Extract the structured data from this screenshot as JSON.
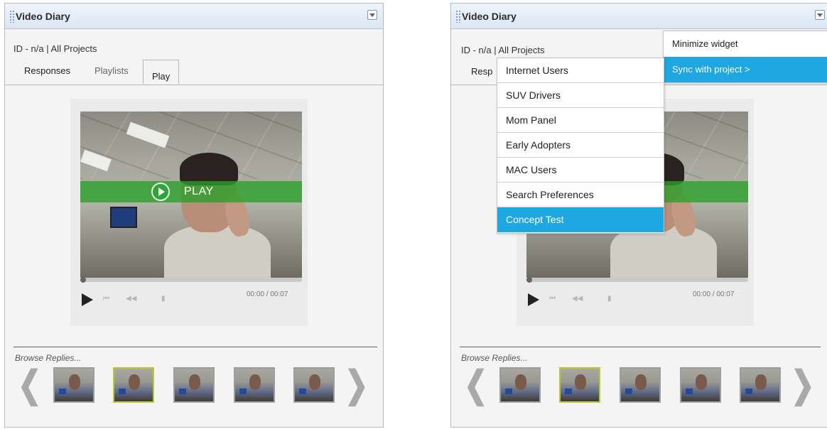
{
  "left": {
    "title": "Video Diary",
    "breadcrumb": "ID - n/a | All Projects",
    "tabs": [
      {
        "label": "Responses"
      },
      {
        "label": "Playlists"
      },
      {
        "label": "Play"
      }
    ],
    "play_overlay": "PLAY",
    "time": "00:00 / 00:07",
    "browse_label": "Browse Replies...",
    "prev_arrow": "❮",
    "next_arrow": "❯"
  },
  "right": {
    "title": "Video Diary",
    "breadcrumb": "ID - n/a | All Projects",
    "tab_partial": "Resp",
    "time": "00:00 / 00:07",
    "browse_label": "Browse Replies...",
    "prev_arrow": "❮",
    "next_arrow": "❯",
    "widget_menu": [
      {
        "label": "Minimize widget"
      },
      {
        "label": "Sync with project >"
      }
    ],
    "project_menu": [
      {
        "label": "Internet Users"
      },
      {
        "label": "SUV Drivers"
      },
      {
        "label": "Mom Panel"
      },
      {
        "label": "Early Adopters"
      },
      {
        "label": "MAC Users"
      },
      {
        "label": "Search Preferences"
      },
      {
        "label": "Concept Test"
      }
    ]
  },
  "colors": {
    "menu_highlight": "#1ea7e1",
    "play_bar": "#2fa23a",
    "selected_thumb_border": "#b9c832"
  },
  "icons": {
    "grip": "drag-handle-icon",
    "menu": "dropdown-menu-icon",
    "play": "play-icon",
    "skip_back": "skip-back-icon",
    "rewind": "rewind-icon",
    "volume": "volume-icon"
  },
  "playback_progress": 0
}
